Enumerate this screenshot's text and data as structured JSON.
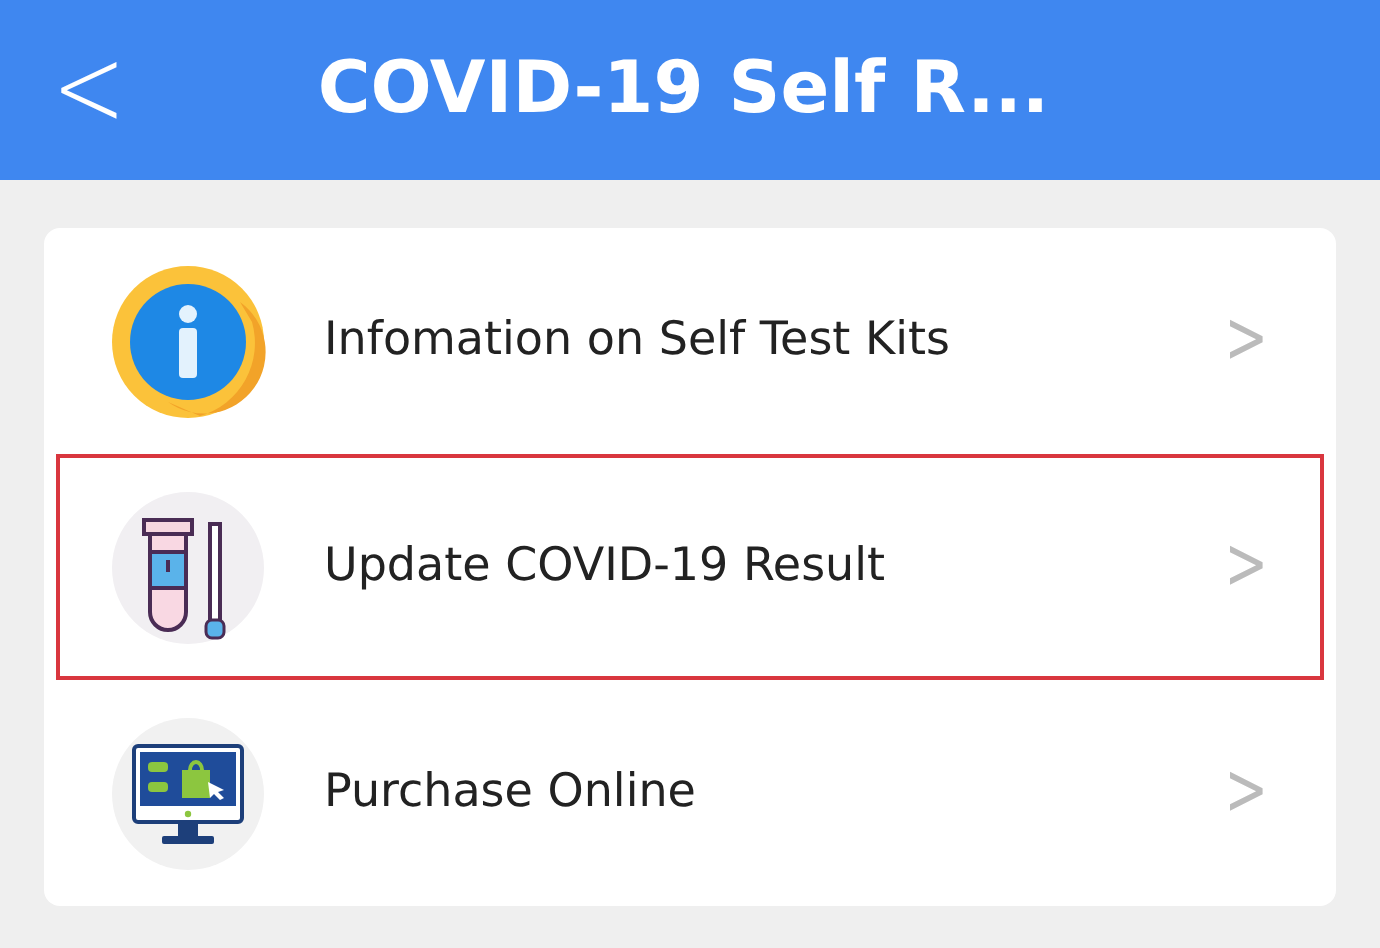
{
  "header": {
    "back": "<",
    "title": "COVID-19 Self R..."
  },
  "items": [
    {
      "kind": "info",
      "label": "Infomation on Self Test Kits",
      "chevron": ">",
      "highlighted": false
    },
    {
      "kind": "tube",
      "label": "Update COVID-19 Result",
      "chevron": ">",
      "highlighted": true
    },
    {
      "kind": "monitor",
      "label": "Purchase Online",
      "chevron": ">",
      "highlighted": false
    }
  ]
}
